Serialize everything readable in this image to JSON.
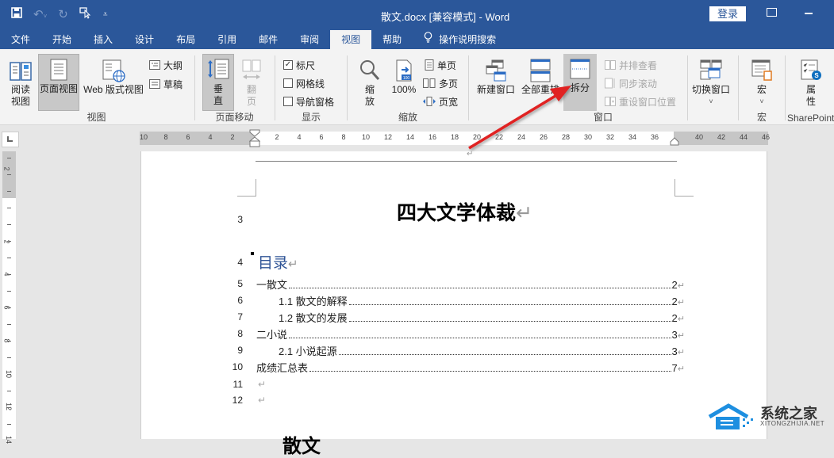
{
  "window": {
    "title": "散文.docx [兼容模式]  -  Word",
    "login_label": "登录"
  },
  "quick_access": {
    "icons": [
      "save-icon",
      "undo-icon",
      "redo-icon",
      "touch-mode-icon",
      "customize-qat-icon"
    ]
  },
  "tabs": [
    {
      "label": "文件",
      "active": false
    },
    {
      "label": "开始",
      "active": false
    },
    {
      "label": "插入",
      "active": false
    },
    {
      "label": "设计",
      "active": false
    },
    {
      "label": "布局",
      "active": false
    },
    {
      "label": "引用",
      "active": false
    },
    {
      "label": "邮件",
      "active": false
    },
    {
      "label": "审阅",
      "active": false
    },
    {
      "label": "视图",
      "active": true
    },
    {
      "label": "帮助",
      "active": false
    }
  ],
  "tell_me": "操作说明搜索",
  "ribbon": {
    "views": {
      "label": "视图",
      "read_mode": "阅读视图",
      "print_layout": "页面视图",
      "web_layout": "Web 版式视图",
      "outline": "大纲",
      "draft": "草稿"
    },
    "page_movement": {
      "label": "页面移动",
      "vertical": "垂直",
      "side_to_side": "翻页"
    },
    "show": {
      "label": "显示",
      "ruler": {
        "label": "标尺",
        "checked": true
      },
      "gridlines": {
        "label": "网格线",
        "checked": false
      },
      "nav_pane": {
        "label": "导航窗格",
        "checked": false
      }
    },
    "zoom": {
      "label": "缩放",
      "zoom": "缩放",
      "hundred": "100%",
      "hundred_badge": "100",
      "one_page": "单页",
      "multiple_pages": "多页",
      "page_width": "页宽"
    },
    "window": {
      "label": "窗口",
      "new_window": "新建窗口",
      "arrange_all": "全部重排",
      "split": "拆分",
      "view_side_by_side": "并排查看",
      "sync_scroll": "同步滚动",
      "reset_position": "重设窗口位置",
      "switch_windows": "切换窗口"
    },
    "macros": {
      "label": "宏",
      "macros": "宏"
    },
    "sharepoint": {
      "label": "SharePoint",
      "properties": "属性"
    }
  },
  "hruler": {
    "ticks": [
      "10",
      "8",
      "6",
      "4",
      "2",
      "2",
      "4",
      "6",
      "8",
      "10",
      "12",
      "14",
      "16",
      "18",
      "20",
      "22",
      "24",
      "26",
      "28",
      "30",
      "32",
      "34",
      "36",
      "40",
      "42",
      "44",
      "46"
    ]
  },
  "vruler": {
    "ticks": [
      "2",
      "2",
      "4",
      "6",
      "8",
      "10",
      "12",
      "14"
    ]
  },
  "document": {
    "heading": "四大文学体裁",
    "toc_title": "目录",
    "toc": [
      {
        "line": "5",
        "label": "一散文",
        "page": "2",
        "indent": 0
      },
      {
        "line": "6",
        "label": "1.1 散文的解释",
        "page": "2",
        "indent": 1
      },
      {
        "line": "7",
        "label": "1.2 散文的发展",
        "page": "2",
        "indent": 1
      },
      {
        "line": "8",
        "label": "二小说",
        "page": "3",
        "indent": 0
      },
      {
        "line": "9",
        "label": "2.1 小说起源",
        "page": "3",
        "indent": 1
      },
      {
        "line": "10",
        "label": "成绩汇总表",
        "page": "7",
        "indent": 0
      }
    ],
    "line_numbers": {
      "heading": "3",
      "toc_title": "4",
      "empty1": "11",
      "empty2": "12"
    },
    "para_mark": "↵",
    "next_heading": "散文"
  },
  "watermark": {
    "cn": "系统之家",
    "en": "XITONGZHIJIA.NET"
  },
  "colors": {
    "accent": "#2b579a",
    "toc_title": "#2f5496",
    "annotation_arrow": "#e02020"
  }
}
